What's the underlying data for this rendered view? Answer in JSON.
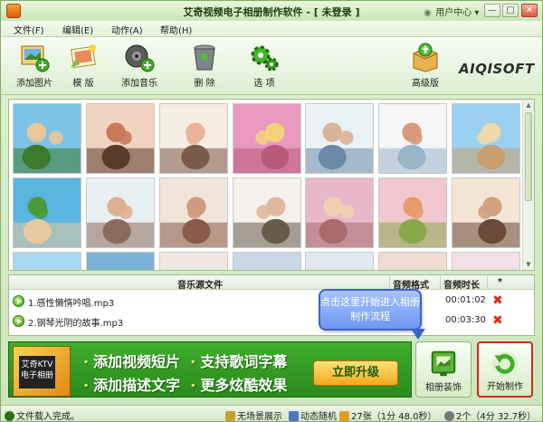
{
  "window": {
    "title": "艾奇视频电子相册制作软件 - [ 未登录 ]",
    "user_center": "用户中心",
    "min_label": "—",
    "max_label": "□",
    "close_label": "✕"
  },
  "menu": [
    "文件(F)",
    "编辑(E)",
    "动作(A)",
    "帮助(H)"
  ],
  "toolbar": {
    "add_image": "添加图片",
    "template": "模 版",
    "add_music": "添加音乐",
    "delete": "删 除",
    "options": "选 项",
    "pro": "高级版",
    "brand": "AIQISOFT"
  },
  "music": {
    "headers": [
      "音乐源文件",
      "音频格式",
      "音频时长",
      "*"
    ],
    "rows": [
      {
        "name": "1.感性懒惰吟唱.mp3",
        "duration": "00:01:02"
      },
      {
        "name": "2.钢琴光阴的故事.mp3",
        "duration": "00:03:30"
      }
    ]
  },
  "callout": "点击这里开始进入相册制作流程",
  "banner": {
    "line1a": "添加视频短片",
    "line1b": "支持歌词字幕",
    "line2a": "添加描述文字",
    "line2b": "更多炫酷效果",
    "upgrade": "立即升级",
    "box_text": "艾奇KTV电子相册"
  },
  "buttons": {
    "decorate": "相册装饰",
    "start": "开始制作"
  },
  "status": {
    "loaded": "文件载入完成。",
    "transition": "无场景展示",
    "random": "动态随机",
    "images": "27张（1分 48.0秒）",
    "music": "2个（4分 32.7秒）"
  },
  "colors": {
    "accent_green": "#3fae2c",
    "callout_blue": "#6d97f2",
    "highlight_red": "#d9261c"
  }
}
